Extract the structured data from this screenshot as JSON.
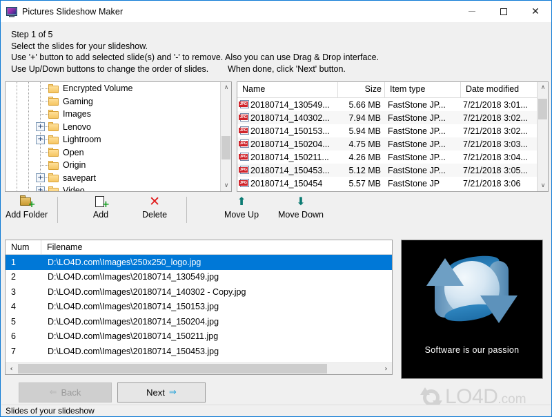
{
  "window": {
    "title": "Pictures Slideshow Maker",
    "icon": "monitor-picture-icon",
    "minimize_label": "–",
    "maximize_label": "□",
    "close_label": "✕",
    "accent_color": "#0a78d4"
  },
  "instructions": {
    "line1": "Step 1 of 5",
    "line2": "Select the slides for your slideshow.",
    "line3": "Use '+' button to add selected slide(s) and '-' to remove. Also you can use Drag & Drop interface.",
    "line4": "Use Up/Down buttons to change the order of slides.        When done, click 'Next' button."
  },
  "tree": {
    "items": [
      {
        "label": "Encrypted Volume",
        "expandable": false
      },
      {
        "label": "Gaming",
        "expandable": false
      },
      {
        "label": "Images",
        "expandable": false
      },
      {
        "label": "Lenovo",
        "expandable": true,
        "expander": "+"
      },
      {
        "label": "Lightroom",
        "expandable": true,
        "expander": "+"
      },
      {
        "label": "Open",
        "expandable": false
      },
      {
        "label": "Origin",
        "expandable": false
      },
      {
        "label": "savepart",
        "expandable": true,
        "expander": "+"
      },
      {
        "label": "Video",
        "expandable": true,
        "expander": "+"
      }
    ],
    "scroll_up": "∧",
    "scroll_down": "∨"
  },
  "filelist": {
    "columns": [
      "Name",
      "Size",
      "Item type",
      "Date modified"
    ],
    "scroll_up": "∧",
    "scroll_down": "∨",
    "rows": [
      {
        "icon": "jpg-file-icon",
        "name": "20180714_130549...",
        "size": "5.66 MB",
        "type": "FastStone JP...",
        "date": "7/21/2018 3:01..."
      },
      {
        "icon": "jpg-file-icon",
        "name": "20180714_140302...",
        "size": "7.94 MB",
        "type": "FastStone JP...",
        "date": "7/21/2018 3:02..."
      },
      {
        "icon": "jpg-file-icon",
        "name": "20180714_150153...",
        "size": "5.94 MB",
        "type": "FastStone JP...",
        "date": "7/21/2018 3:02..."
      },
      {
        "icon": "jpg-file-icon",
        "name": "20180714_150204...",
        "size": "4.75 MB",
        "type": "FastStone JP...",
        "date": "7/21/2018 3:03..."
      },
      {
        "icon": "jpg-file-icon",
        "name": "20180714_150211...",
        "size": "4.26 MB",
        "type": "FastStone JP...",
        "date": "7/21/2018 3:04..."
      },
      {
        "icon": "jpg-file-icon",
        "name": "20180714_150453...",
        "size": "5.12 MB",
        "type": "FastStone JP...",
        "date": "7/21/2018 3:05..."
      },
      {
        "icon": "jpg-file-icon",
        "name": "20180714_150454",
        "size": "5.57 MB",
        "type": "FastStone JP",
        "date": "7/21/2018 3:06"
      }
    ]
  },
  "toolbar": {
    "buttons": [
      {
        "label": "Add Folder",
        "icon": "add-folder-icon"
      },
      {
        "label": "Add",
        "icon": "add-file-icon"
      },
      {
        "label": "Delete",
        "icon": "delete-x-icon"
      },
      {
        "label": "Move Up",
        "icon": "arrow-up-icon"
      },
      {
        "label": "Move Down",
        "icon": "arrow-down-icon"
      }
    ]
  },
  "slidelist": {
    "columns": [
      "Num",
      "Filename"
    ],
    "selected_index": 0,
    "rows": [
      {
        "num": "1",
        "filename": "D:\\LO4D.com\\Images\\250x250_logo.jpg"
      },
      {
        "num": "2",
        "filename": "D:\\LO4D.com\\Images\\20180714_130549.jpg"
      },
      {
        "num": "3",
        "filename": "D:\\LO4D.com\\Images\\20180714_140302 - Copy.jpg"
      },
      {
        "num": "4",
        "filename": "D:\\LO4D.com\\Images\\20180714_150153.jpg"
      },
      {
        "num": "5",
        "filename": "D:\\LO4D.com\\Images\\20180714_150204.jpg"
      },
      {
        "num": "6",
        "filename": "D:\\LO4D.com\\Images\\20180714_150211.jpg"
      },
      {
        "num": "7",
        "filename": "D:\\LO4D.com\\Images\\20180714_150453.jpg"
      }
    ],
    "scroll_left": "‹",
    "scroll_right": "›",
    "selection_color": "#0078d7"
  },
  "preview": {
    "image_name": "250x250_logo.jpg",
    "tagline": "Software is our passion",
    "background": "#000000"
  },
  "navigation": {
    "back_label": "Back",
    "back_arrow": "⇐",
    "back_disabled": true,
    "next_label": "Next",
    "next_arrow": "⇒"
  },
  "watermark": {
    "brand": "LO4D",
    "suffix": ".com"
  },
  "statusbar": {
    "text": "Slides of your slideshow"
  }
}
